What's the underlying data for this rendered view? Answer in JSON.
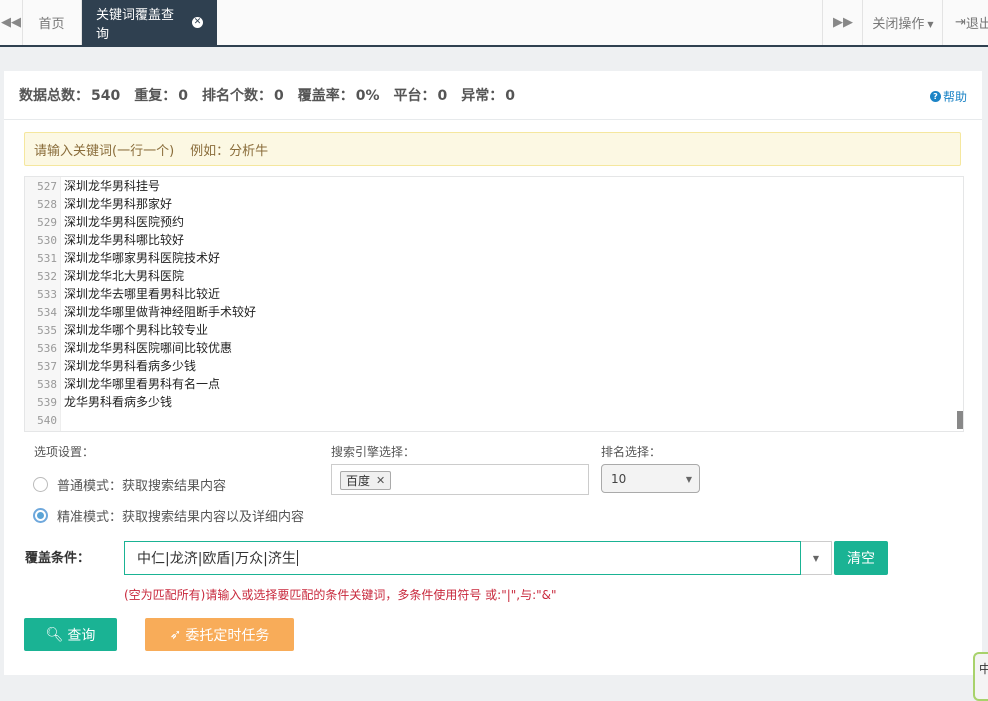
{
  "topbar": {
    "prev_icon": "double-left-icon",
    "home_tab": "首页",
    "active_tab": "关键词覆盖查询",
    "next_icon": "double-right-icon",
    "close_ops": "关闭操作",
    "logout": "退出"
  },
  "stats": {
    "total_label": "数据总数：",
    "total": "540",
    "dup_label": "重复：",
    "dup": "0",
    "rank_label": "排名个数：",
    "rank": "0",
    "cover_label": "覆盖率：",
    "cover": "0%",
    "platform_label": "平台：",
    "platform": "0",
    "abnormal_label": "异常：",
    "abnormal": "0"
  },
  "help": "帮助",
  "hint": {
    "text": "请输入关键词(一行一个)",
    "example": "例如：分析牛"
  },
  "editor": {
    "lines": [
      {
        "n": "527",
        "t": "深圳龙华男科挂号"
      },
      {
        "n": "528",
        "t": "深圳龙华男科那家好"
      },
      {
        "n": "529",
        "t": "深圳龙华男科医院预约"
      },
      {
        "n": "530",
        "t": "深圳龙华男科哪比较好"
      },
      {
        "n": "531",
        "t": "深圳龙华哪家男科医院技术好"
      },
      {
        "n": "532",
        "t": "深圳龙华北大男科医院"
      },
      {
        "n": "533",
        "t": "深圳龙华去哪里看男科比较近"
      },
      {
        "n": "534",
        "t": "深圳龙华哪里做背神经阻断手术较好"
      },
      {
        "n": "535",
        "t": "深圳龙华哪个男科比较专业"
      },
      {
        "n": "536",
        "t": "深圳龙华男科医院哪间比较优惠"
      },
      {
        "n": "537",
        "t": "深圳龙华男科看病多少钱"
      },
      {
        "n": "538",
        "t": "深圳龙华哪里看男科有名一点"
      },
      {
        "n": "539",
        "t": "龙华男科看病多少钱"
      },
      {
        "n": "540",
        "t": ""
      }
    ]
  },
  "options": {
    "title": "选项设置：",
    "normal_mode": "普通模式：获取搜索结果内容",
    "precise_mode": "精准模式：获取搜索结果内容以及详细内容",
    "selected": "precise"
  },
  "engine": {
    "title": "搜索引擎选择：",
    "selected_tag": "百度",
    "remove": "✕"
  },
  "ranking": {
    "title": "排名选择：",
    "value": "10"
  },
  "cover": {
    "label": "覆盖条件：",
    "value": "中仁|龙济|欧盾|万众|济生",
    "clear_button": "清空",
    "warning": "(空为匹配所有)请输入或选择要匹配的条件关键词，多条件使用符号 或:\"|\",与:\"&\""
  },
  "buttons": {
    "query": "查询",
    "delegate": "委托定时任务"
  },
  "side_float": "中",
  "colors": {
    "primary": "#1ab394",
    "warning": "#f8ac59",
    "dark": "#2f4050",
    "link": "#1c84c6",
    "danger": "#c8283c"
  }
}
